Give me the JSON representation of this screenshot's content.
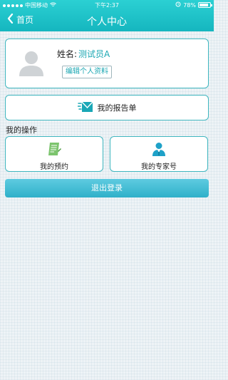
{
  "status_bar": {
    "carrier": "中国移动",
    "time": "下午2:37",
    "battery": "78%"
  },
  "header": {
    "back_label": "首页",
    "title": "个人中心"
  },
  "profile": {
    "name_label": "姓名:",
    "name_value": "测试员A",
    "edit_label": "编辑个人资料"
  },
  "report": {
    "label": "我的报告单"
  },
  "operations": {
    "section_label": "我的操作",
    "items": [
      {
        "label": "我的预约",
        "icon": "appointment-icon"
      },
      {
        "label": "我的专家号",
        "icon": "expert-icon"
      }
    ]
  },
  "logout": {
    "label": "退出登录"
  },
  "colors": {
    "accent": "#1cc0c6",
    "border": "#3fb6bf",
    "button": "#3fb8d2"
  }
}
